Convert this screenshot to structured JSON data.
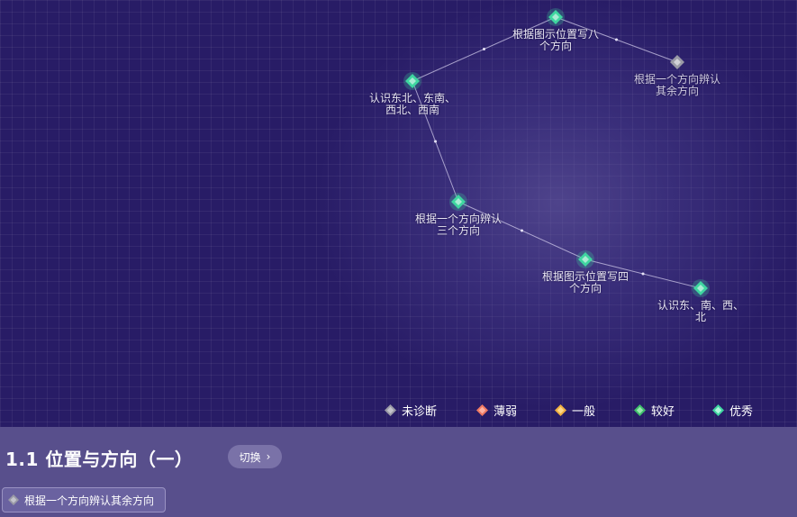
{
  "map": {
    "nodes": [
      {
        "id": "n1",
        "label_lines": [
          "根据图示位置写八",
          "个方向"
        ],
        "status": "excellent"
      },
      {
        "id": "n2",
        "label_lines": [
          "根据一个方向辨认",
          "其余方向"
        ],
        "status": "undiagnosed"
      },
      {
        "id": "n3",
        "label_lines": [
          "认识东北、东南、",
          "西北、西南"
        ],
        "status": "excellent"
      },
      {
        "id": "n4",
        "label_lines": [
          "根据一个方向辨认",
          "三个方向"
        ],
        "status": "excellent"
      },
      {
        "id": "n5",
        "label_lines": [
          "根据图示位置写四",
          "个方向"
        ],
        "status": "excellent"
      },
      {
        "id": "n6",
        "label_lines": [
          "认识东、南、西、",
          "北"
        ],
        "status": "excellent"
      }
    ],
    "edges": [
      [
        "n1",
        "n2"
      ],
      [
        "n1",
        "n3"
      ],
      [
        "n3",
        "n4"
      ],
      [
        "n4",
        "n5"
      ],
      [
        "n5",
        "n6"
      ]
    ]
  },
  "legend": {
    "items": [
      {
        "key": "undiagnosed",
        "label": "未诊断",
        "color": "#9a9aa6"
      },
      {
        "key": "weak",
        "label": "薄弱",
        "color": "#f07a62"
      },
      {
        "key": "average",
        "label": "一般",
        "color": "#f0b040"
      },
      {
        "key": "good",
        "label": "较好",
        "color": "#3fbf6a"
      },
      {
        "key": "excellent",
        "label": "优秀",
        "color": "#3fd6a0"
      }
    ]
  },
  "unit": {
    "title": "1.1 位置与方向（一）",
    "switch_label": "切换",
    "switch_chevron": "›"
  },
  "current_point": {
    "label": "根据一个方向辨认其余方向",
    "icon": "diamond-icon",
    "status": "undiagnosed"
  }
}
